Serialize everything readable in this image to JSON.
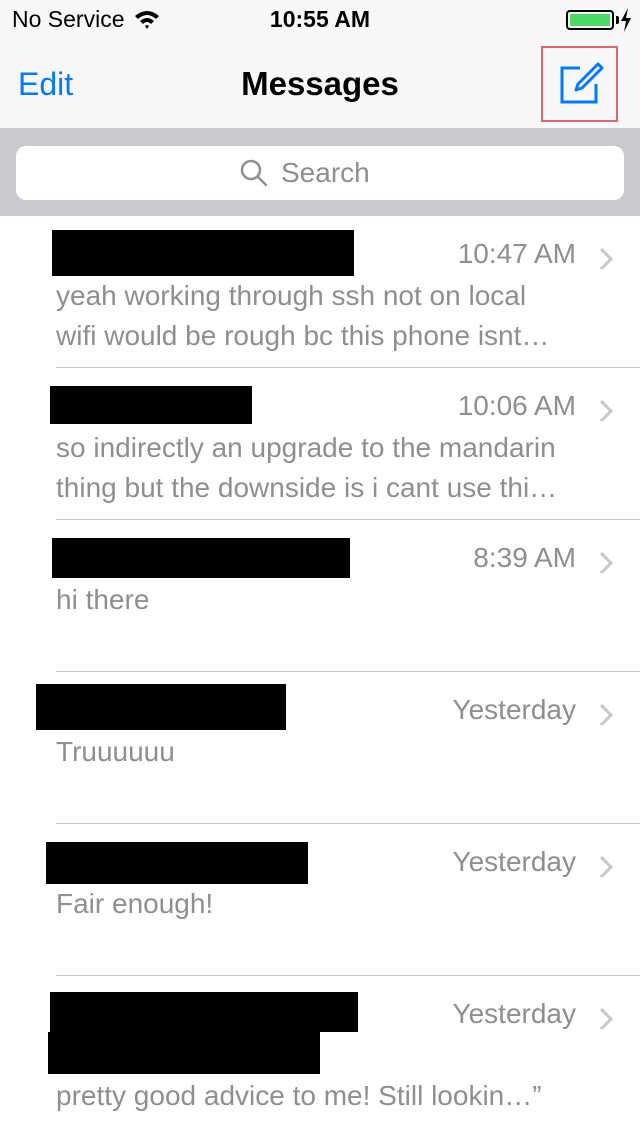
{
  "status_bar": {
    "carrier": "No Service",
    "time": "10:55 AM",
    "battery_level": 1.0,
    "icons": [
      "wifi-icon",
      "battery-icon",
      "charging-bolt-icon"
    ]
  },
  "nav": {
    "edit_label": "Edit",
    "title": "Messages",
    "compose_icon": "compose-icon"
  },
  "search": {
    "placeholder": "Search",
    "icon": "magnifier-icon"
  },
  "conversations": [
    {
      "sender": "",
      "time": "10:47 AM",
      "preview": "yeah working through ssh not on local\nwifi would be rough bc this phone isnt…"
    },
    {
      "sender": "",
      "time": "10:06 AM",
      "preview": "so indirectly an upgrade to the mandarin\nthing but the downside is i cant use thi…"
    },
    {
      "sender": "",
      "time": "8:39 AM",
      "preview": "hi there"
    },
    {
      "sender": "",
      "time": "Yesterday",
      "preview": "Truuuuuu"
    },
    {
      "sender": "",
      "time": "Yesterday",
      "preview": "Fair enough!"
    },
    {
      "sender": "",
      "time": "Yesterday",
      "preview": "                         liked “Sounds like\npretty good advice to me! Still lookin…”"
    }
  ],
  "colors": {
    "accent": "#007aff",
    "secondary_text": "#8e8e93",
    "bar_background": "#f7f7f7",
    "search_background": "#c9c9ce",
    "battery": "#4cd964",
    "compose_highlight": "#e0666b"
  }
}
